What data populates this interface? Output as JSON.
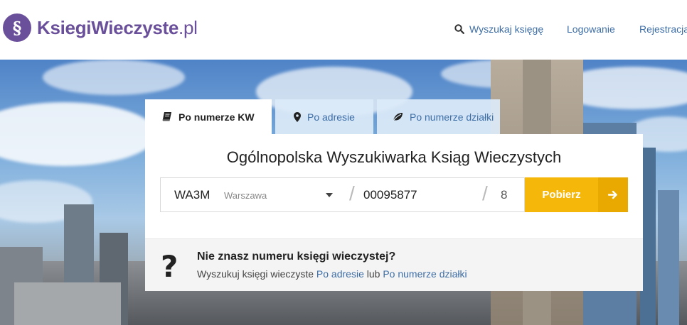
{
  "header": {
    "logo_symbol": "§",
    "logo_bold": "Ksiegi",
    "logo_light_1": "Wieczyste",
    "logo_suffix": ".pl",
    "nav": {
      "search_label": "Wyszukaj księgę",
      "login_label": "Logowanie",
      "register_label": "Rejestracja"
    }
  },
  "tabs": [
    {
      "label": "Po numerze KW",
      "icon": "book-icon",
      "active": true
    },
    {
      "label": "Po adresie",
      "icon": "map-marker-icon",
      "active": false
    },
    {
      "label": "Po numerze działki",
      "icon": "leaf-icon",
      "active": false
    }
  ],
  "panel": {
    "title": "Ogólnopolska Wyszukiwarka Ksiąg Wieczystych",
    "court_code": "WA3M",
    "court_city": "Warszawa",
    "separator": "/",
    "book_number": "00095877",
    "control_digit": "8",
    "fetch_label": "Pobierz"
  },
  "help": {
    "question_mark": "?",
    "title": "Nie znasz numeru księgi wieczystej?",
    "text_prefix": "Wyszukuj księgi wieczyste",
    "link_address": "Po adresie",
    "text_middle": "lub",
    "link_plot": "Po numerze działki"
  },
  "colors": {
    "brand": "#6a4f9a",
    "link": "#3d6ea6",
    "accent": "#f5b70a"
  }
}
